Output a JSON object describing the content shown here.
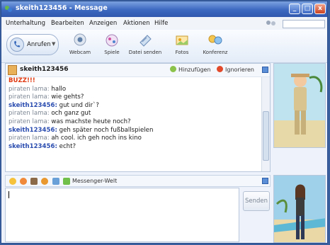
{
  "window": {
    "title": "skeith123456 - Message",
    "buttons": {
      "minimize": "_",
      "maximize": "□",
      "close": "x"
    }
  },
  "menubar": {
    "items": [
      "Unterhaltung",
      "Bearbeiten",
      "Anzeigen",
      "Aktionen",
      "Hilfe"
    ]
  },
  "toolbar": {
    "call_label": "Anrufen",
    "items": [
      {
        "label": "Webcam",
        "icon": "webcam-icon"
      },
      {
        "label": "Spiele",
        "icon": "games-icon"
      },
      {
        "label": "Datei senden",
        "icon": "file-send-icon"
      },
      {
        "label": "Fotos",
        "icon": "photos-icon"
      },
      {
        "label": "Konferenz",
        "icon": "conference-icon"
      }
    ]
  },
  "conversation": {
    "contact_name": "skeith123456",
    "add_label": "Hinzufügen",
    "ignore_label": "Ignorieren",
    "buzz": "BUZZ!!!",
    "messages": [
      {
        "speaker": "piraten lama:",
        "text": "hallo",
        "self": false
      },
      {
        "speaker": "piraten lama:",
        "text": "wie gehts?",
        "self": false
      },
      {
        "speaker": "skeith123456:",
        "text": "gut und dir`?",
        "self": true
      },
      {
        "speaker": "piraten lama:",
        "text": "och ganz gut",
        "self": false
      },
      {
        "speaker": "piraten lama:",
        "text": "was machste heute noch?",
        "self": false
      },
      {
        "speaker": "skeith123456:",
        "text": "geh später noch fußballspielen",
        "self": true
      },
      {
        "speaker": "piraten lama:",
        "text": "ah cool. ich geh noch ins kino",
        "self": false
      },
      {
        "speaker": "skeith123456:",
        "text": "echt?",
        "self": true
      }
    ]
  },
  "compose": {
    "messenger_world_label": "Messenger-Welt",
    "send_label": "Senden",
    "value": ""
  },
  "colors": {
    "titlebar": "#3c68c0",
    "buzz": "#e03a12",
    "self_speaker": "#2b4db0",
    "other_speaker": "#7d8794"
  }
}
